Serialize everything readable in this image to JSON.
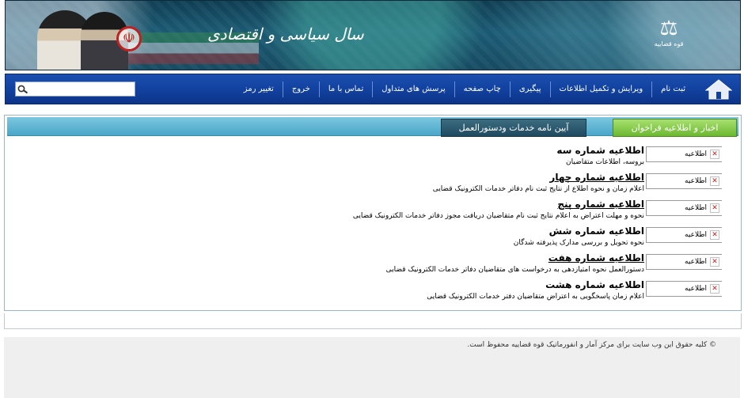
{
  "banner": {
    "slogan": "سال سیاسی و اقتصادی",
    "logo_caption": "قوه قضاییه"
  },
  "nav": {
    "items": [
      {
        "label": "ثبت نام"
      },
      {
        "label": "ویرایش و تکمیل اطلاعات"
      },
      {
        "label": "پیگیری"
      },
      {
        "label": "چاپ صفحه"
      },
      {
        "label": "پرسش های متداول"
      },
      {
        "label": "تماس با ما"
      },
      {
        "label": "خروج"
      },
      {
        "label": "تغییر رمز"
      }
    ],
    "search": {
      "value": "",
      "placeholder": ""
    }
  },
  "tabs": {
    "active": "اخبار و اطلاعیه فراخوان",
    "inactive": "آیین نامه خدمات ودستورالعمل"
  },
  "news": [
    {
      "img_alt": "اطلاعیه",
      "title": "اطلاعیه شماره سه",
      "underline": false,
      "desc": "بروسه، اطلاعات متقاضیان"
    },
    {
      "img_alt": "اطلاعیه",
      "title": "اطلاعیه شماره چهار",
      "underline": true,
      "desc": "اعلام زمان و نحوه اطلاع از نتایج ثبت نام دفاتر خدمات الکترونیک قضایی"
    },
    {
      "img_alt": "اطلاعیه",
      "title": "اطلاعیه شماره پنج",
      "underline": true,
      "desc": "نحوه و مهلت اعتراض به اعلام نتایج ثبت نام متقاضیان دریافت مجوز دفاتر خدمات الکترونیک قضایی"
    },
    {
      "img_alt": "اطلاعیه",
      "title": "اطلاعیه شماره شش",
      "underline": false,
      "desc": "نحوه تحویل و بررسی مدارک پذیرفته شدگان"
    },
    {
      "img_alt": "اطلاعیه",
      "title": "اطلاعیه شماره هفت",
      "underline": true,
      "desc": "دستورالعمل نحوه امتیازدهی به درخواست های متقاضیان دفاتر خدمات الکترونیک قضایی"
    },
    {
      "img_alt": "اطلاعیه",
      "title": "اطلاعیه شماره هشت",
      "underline": false,
      "desc": "اعلام زمان پاسخگویی به اعتراض متقاضیان دفتر خدمات الکترونیک قضایی"
    }
  ],
  "footer": {
    "copyright": "© کلیه حقوق این وب سایت برای مرکز آمار و انفورماتیک قوه قضاییه محفوظ است."
  },
  "colors": {
    "nav_bg": "#1242a0",
    "tab_active": "#6cb830",
    "tab_inactive": "#1e4a60",
    "tabbar": "#4aa6c8",
    "broken_x": "#d02020"
  }
}
